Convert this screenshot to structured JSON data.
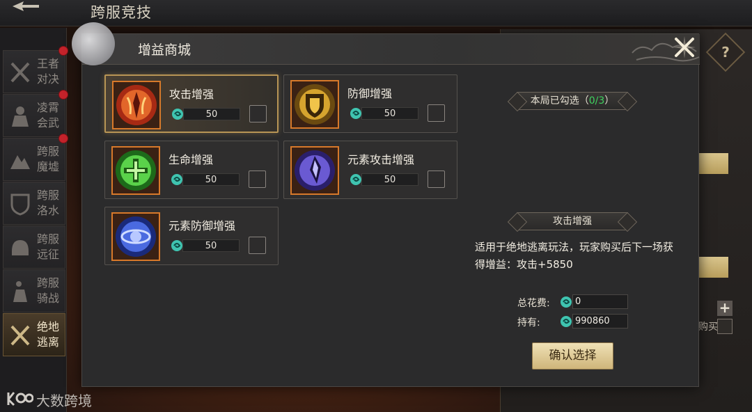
{
  "header": {
    "title": "跨服竞技"
  },
  "sidebar": {
    "items": [
      {
        "label": "王者对决",
        "icon": "crossed-swords-icon",
        "badge": true,
        "active": false
      },
      {
        "label": "凌霄会武",
        "icon": "warrior-icon",
        "badge": true,
        "active": false
      },
      {
        "label": "跨服魔墟",
        "icon": "mountain-icon",
        "badge": true,
        "active": false
      },
      {
        "label": "跨服洛水",
        "icon": "shield-icon",
        "badge": false,
        "active": false
      },
      {
        "label": "跨服远征",
        "icon": "helmet-icon",
        "badge": false,
        "active": false
      },
      {
        "label": "跨服骑战",
        "icon": "horseman-icon",
        "badge": false,
        "active": false
      },
      {
        "label": "绝地逃离",
        "icon": "crossed-swords-icon",
        "badge": false,
        "active": true
      }
    ]
  },
  "background": {
    "buy_label": "购买"
  },
  "watermark": {
    "text": "大数跨境"
  },
  "modal": {
    "title": "增益商城",
    "items": [
      {
        "name": "攻击增强",
        "price": "50",
        "icon": "attack-boost-icon",
        "selected": true
      },
      {
        "name": "防御增强",
        "price": "50",
        "icon": "defense-boost-icon",
        "selected": false
      },
      {
        "name": "生命增强",
        "price": "50",
        "icon": "health-boost-icon",
        "selected": false
      },
      {
        "name": "元素攻击增强",
        "price": "50",
        "icon": "elemental-attack-icon",
        "selected": false
      },
      {
        "name": "元素防御增强",
        "price": "50",
        "icon": "elemental-defense-icon",
        "selected": false
      }
    ],
    "selected_label": "本局已勾选（",
    "selected_count": "0/3",
    "selected_suffix": "）",
    "detail_title": "攻击增强",
    "detail_desc": "适用于绝地逃离玩法，玩家购买后下一场获得增益：攻击+5850",
    "total_cost_label": "总花费:",
    "total_cost": "0",
    "holding_label": "持有:",
    "holding": "990860",
    "confirm_label": "确认选择"
  },
  "colors": {
    "accent_gold": "#d8c48c",
    "selected_count_green": "#3ed35f",
    "badge_red": "#c4232b",
    "icon_frame": "#d8792a"
  }
}
